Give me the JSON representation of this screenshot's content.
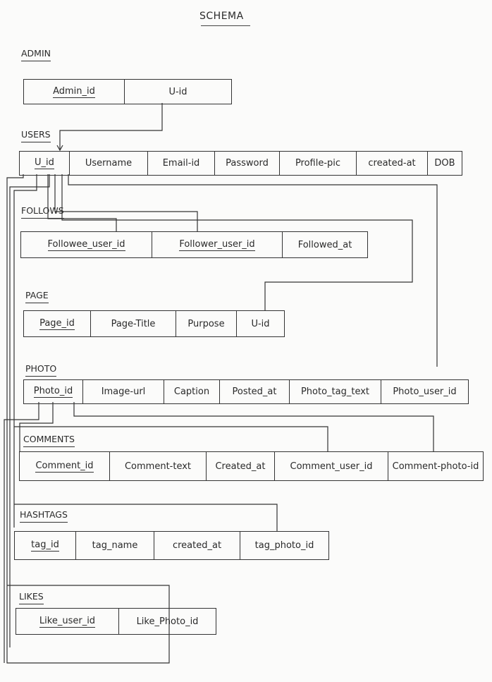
{
  "title": "SCHEMA",
  "tables": [
    {
      "id": "admin",
      "label": "ADMIN",
      "columns": [
        {
          "name": "Admin_id",
          "pk": true
        },
        {
          "name": "U-id"
        }
      ]
    },
    {
      "id": "users",
      "label": "USERS",
      "columns": [
        {
          "name": "U_id",
          "pk": true
        },
        {
          "name": "Username"
        },
        {
          "name": "Email-id"
        },
        {
          "name": "Password"
        },
        {
          "name": "Profile-pic"
        },
        {
          "name": "created-at"
        },
        {
          "name": "DOB"
        }
      ]
    },
    {
      "id": "follows",
      "label": "FOLLOWS",
      "columns": [
        {
          "name": "Followee_user_id",
          "pk": true
        },
        {
          "name": "Follower_user_id",
          "pk": true
        },
        {
          "name": "Followed_at"
        }
      ]
    },
    {
      "id": "page",
      "label": "PAGE",
      "columns": [
        {
          "name": "Page_id",
          "pk": true
        },
        {
          "name": "Page-Title"
        },
        {
          "name": "Purpose"
        },
        {
          "name": "U-id"
        }
      ]
    },
    {
      "id": "photo",
      "label": "PHOTO",
      "columns": [
        {
          "name": "Photo_id",
          "pk": true
        },
        {
          "name": "Image-url"
        },
        {
          "name": "Caption"
        },
        {
          "name": "Posted_at"
        },
        {
          "name": "Photo_tag_text"
        },
        {
          "name": "Photo_user_id"
        }
      ]
    },
    {
      "id": "comments",
      "label": "COMMENTS",
      "columns": [
        {
          "name": "Comment_id",
          "pk": true
        },
        {
          "name": "Comment-text"
        },
        {
          "name": "Created_at"
        },
        {
          "name": "Comment_user_id"
        },
        {
          "name": "Comment-photo-id"
        }
      ]
    },
    {
      "id": "hashtags",
      "label": "HASHTAGS",
      "columns": [
        {
          "name": "tag_id",
          "pk": true
        },
        {
          "name": "tag_name"
        },
        {
          "name": "created_at"
        },
        {
          "name": "tag_photo_id"
        }
      ]
    },
    {
      "id": "likes",
      "label": "LIKES",
      "columns": [
        {
          "name": "Like_user_id",
          "pk": true
        },
        {
          "name": "Like_Photo_id"
        }
      ]
    }
  ]
}
